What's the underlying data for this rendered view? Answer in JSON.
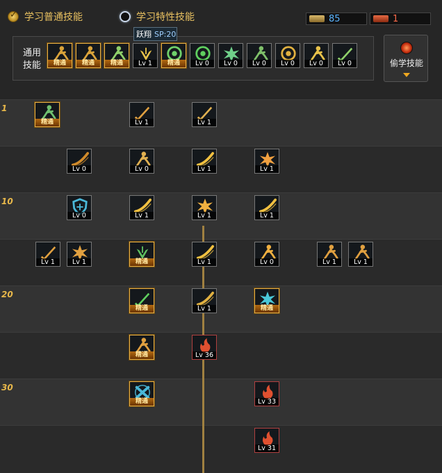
{
  "tabs": [
    {
      "label": "学习普通技能",
      "active": true
    },
    {
      "label": "学习特性技能",
      "active": false
    }
  ],
  "points": {
    "sp": "85",
    "tp": "1"
  },
  "tooltip": {
    "name": "跃翔",
    "sp": "SP:20"
  },
  "common": {
    "label_line1": "通用",
    "label_line2": "技能",
    "skills": [
      {
        "label": "精通",
        "mastered": true,
        "icon": "sitting-figure-icon",
        "color": "#d9a33a"
      },
      {
        "label": "精通",
        "mastered": true,
        "icon": "kneeling-figure-icon",
        "color": "#d9a33a"
      },
      {
        "label": "精通",
        "mastered": true,
        "icon": "leaping-figure-icon",
        "color": "#8fd06a"
      },
      {
        "label": "Lv 1",
        "mastered": false,
        "icon": "wings-icon",
        "color": "#e8c24a"
      },
      {
        "label": "精通",
        "mastered": true,
        "icon": "crosshair-icon",
        "color": "#6fd06a"
      },
      {
        "label": "Lv 0",
        "mastered": false,
        "icon": "target-cross-icon",
        "color": "#5fcf5f"
      },
      {
        "label": "Lv 0",
        "mastered": false,
        "icon": "burst-figure-icon",
        "color": "#6fd08a"
      },
      {
        "label": "Lv 0",
        "mastered": false,
        "icon": "gear-figure-icon",
        "color": "#7fc06a"
      },
      {
        "label": "Lv 0",
        "mastered": false,
        "icon": "eye-ring-icon",
        "color": "#e0b040"
      },
      {
        "label": "Lv 0",
        "mastered": false,
        "icon": "flexing-figure-icon",
        "color": "#e8c24a"
      },
      {
        "label": "Lv 0",
        "mastered": false,
        "icon": "sword-figure-icon",
        "color": "#8fd06a"
      }
    ]
  },
  "steal": {
    "label": "偷学技能"
  },
  "levels": [
    "1",
    "10",
    "20",
    "30"
  ],
  "tree": [
    {
      "label": "精通",
      "mastered": true,
      "icon": "claw-strike-icon",
      "color": "#6fc070"
    },
    {
      "label": "Lv 1",
      "mastered": false,
      "icon": "kunai-icon",
      "color": "#e0a040"
    },
    {
      "label": "Lv 1",
      "mastered": false,
      "icon": "sword-upgrade-icon",
      "color": "#e0b050"
    },
    {
      "label": "Lv 0",
      "mastered": false,
      "icon": "whip-icon",
      "color": "#d08a2a"
    },
    {
      "label": "Lv 0",
      "mastered": false,
      "icon": "dash-figure-icon",
      "color": "#e0b050"
    },
    {
      "label": "Lv 1",
      "mastered": false,
      "icon": "crescent-slash-icon",
      "color": "#f0c040"
    },
    {
      "label": "Lv 1",
      "mastered": false,
      "icon": "fireball-icon",
      "color": "#f0a040"
    },
    {
      "label": "Lv 0",
      "mastered": false,
      "icon": "shield-icon",
      "color": "#4ab8d8"
    },
    {
      "label": "Lv 1",
      "mastered": false,
      "icon": "swift-slash-icon",
      "color": "#f0c040"
    },
    {
      "label": "Lv 1",
      "mastered": false,
      "icon": "explosion-icon",
      "color": "#f0b040"
    },
    {
      "label": "Lv 1",
      "mastered": false,
      "icon": "double-slash-icon",
      "color": "#f0c040"
    },
    {
      "label": "Lv 1",
      "mastered": false,
      "icon": "staff-figure-icon",
      "color": "#e0a040"
    },
    {
      "label": "Lv 1",
      "mastered": false,
      "icon": "spark-icon",
      "color": "#e0a040"
    },
    {
      "label": "精通",
      "mastered": true,
      "icon": "hood-icon",
      "color": "#5fc060"
    },
    {
      "label": "Lv 1",
      "mastered": false,
      "icon": "burst-slash-icon",
      "color": "#f0c040"
    },
    {
      "label": "Lv 0",
      "mastered": false,
      "icon": "running-strike-icon",
      "color": "#f0b040"
    },
    {
      "label": "Lv 1",
      "mastered": false,
      "icon": "flip-kick-icon",
      "color": "#e0a040"
    },
    {
      "label": "Lv 1",
      "mastered": false,
      "icon": "spin-strike-icon",
      "color": "#e0a040"
    },
    {
      "label": "精通",
      "mastered": true,
      "icon": "green-blade-icon",
      "color": "#5fcf5f"
    },
    {
      "label": "Lv 1",
      "mastered": false,
      "icon": "bow-icon",
      "color": "#e0b040"
    },
    {
      "label": "精通",
      "mastered": true,
      "icon": "spirit-icon",
      "color": "#4ac8d8"
    },
    {
      "label": "精通",
      "mastered": true,
      "icon": "stance-figure-icon",
      "color": "#e0a040"
    },
    {
      "label": "Lv 36",
      "mastered": false,
      "icon": "fire-figure-icon",
      "color": "#e05030"
    },
    {
      "label": "精通",
      "mastered": true,
      "icon": "x-orb-icon",
      "color": "#4ab8d8"
    },
    {
      "label": "Lv 33",
      "mastered": false,
      "icon": "fire-tornado-icon",
      "color": "#e05030"
    },
    {
      "label": "Lv 31",
      "mastered": false,
      "icon": "fire-swirl-icon",
      "color": "#e05030"
    }
  ]
}
